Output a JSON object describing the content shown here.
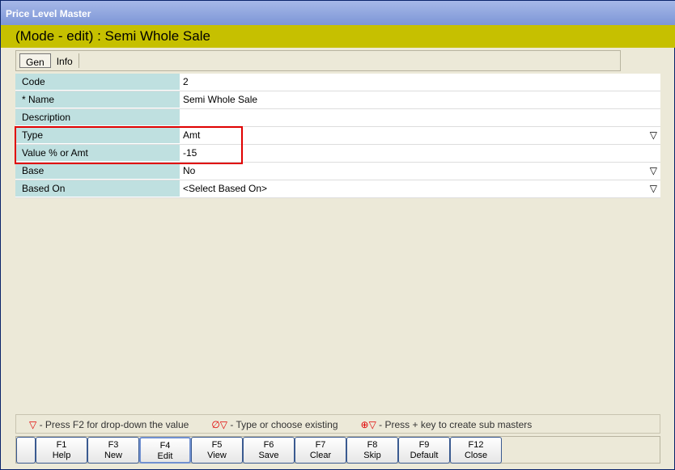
{
  "window": {
    "title": "Price Level Master"
  },
  "mode_bar": "(Mode - edit)  :  Semi Whole Sale",
  "tabs": [
    {
      "label": "Gen"
    },
    {
      "label": "Info"
    }
  ],
  "fields": [
    {
      "label": "Code",
      "value": "2",
      "dropdown": false
    },
    {
      "label": "* Name",
      "value": "Semi Whole Sale",
      "dropdown": false
    },
    {
      "label": "Description",
      "value": "",
      "dropdown": false
    },
    {
      "label": "Type",
      "value": "Amt",
      "dropdown": true
    },
    {
      "label": "Value % or Amt",
      "value": "-15",
      "dropdown": false
    },
    {
      "label": "Base",
      "value": "No",
      "dropdown": true
    },
    {
      "label": "Based On",
      "value": "<Select Based On>",
      "dropdown": true
    }
  ],
  "legend": [
    {
      "icon": "▽",
      "text": " - Press F2 for drop-down the value"
    },
    {
      "icon": "∅▽",
      "text": " - Type or choose existing"
    },
    {
      "icon": "⊕▽",
      "text": " - Press + key to create sub masters"
    }
  ],
  "fkeys": [
    {
      "key": "F1",
      "label": "Help"
    },
    {
      "key": "F3",
      "label": "New"
    },
    {
      "key": "F4",
      "label": "Edit"
    },
    {
      "key": "F5",
      "label": "View"
    },
    {
      "key": "F6",
      "label": "Save"
    },
    {
      "key": "F7",
      "label": "Clear"
    },
    {
      "key": "F8",
      "label": "Skip"
    },
    {
      "key": "F9",
      "label": "Default"
    },
    {
      "key": "F12",
      "label": "Close"
    }
  ],
  "dropdown_glyph": "▽"
}
